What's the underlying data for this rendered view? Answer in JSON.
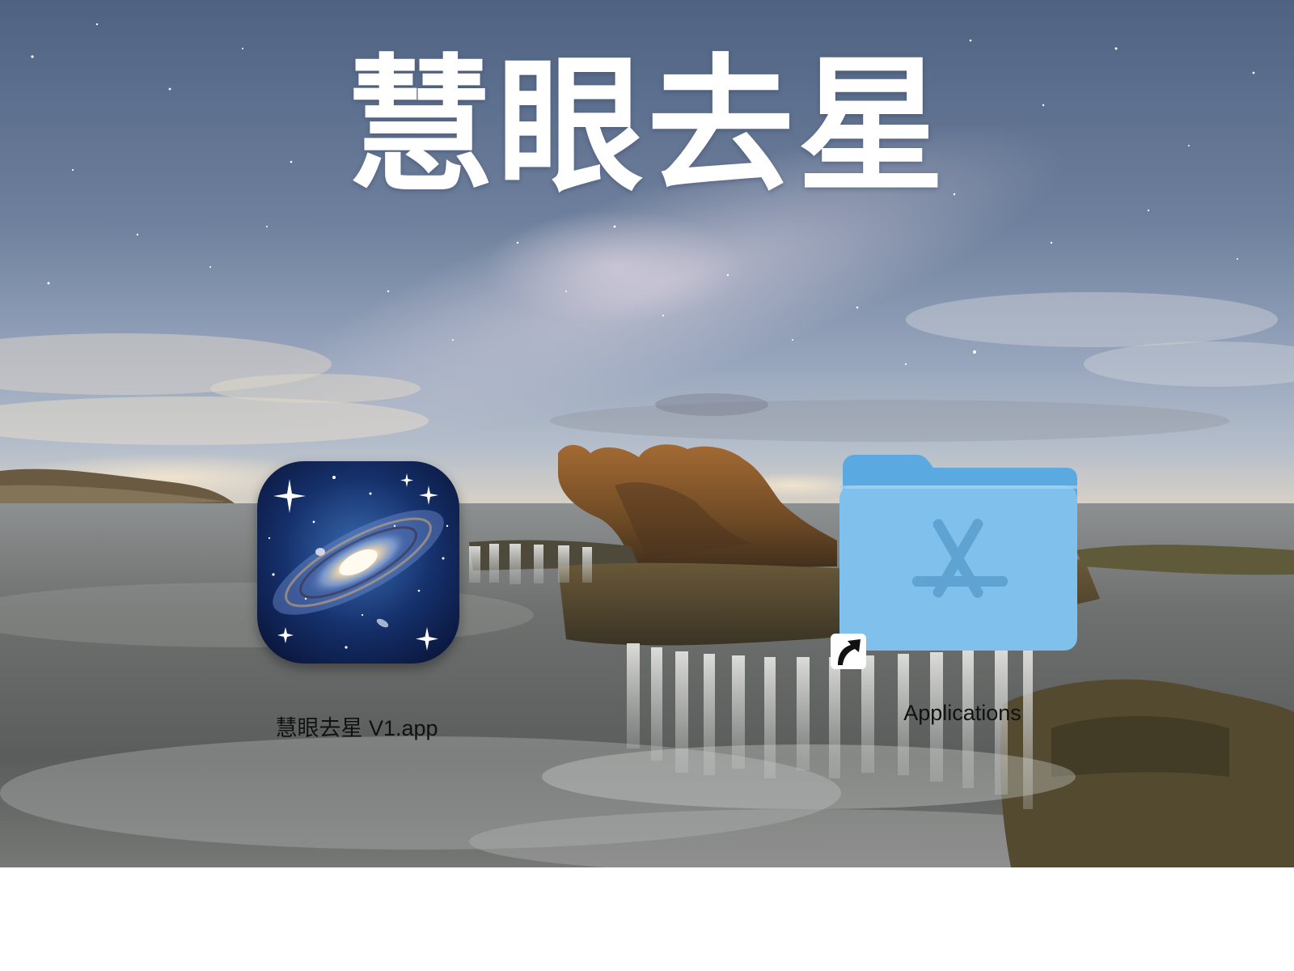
{
  "window": {
    "title_banner": "慧眼去星"
  },
  "items": [
    {
      "label": "慧眼去星 V1.app",
      "kind": "application",
      "icon": "galaxy-app-icon"
    },
    {
      "label": "Applications",
      "kind": "folder-alias",
      "icon": "applications-folder-icon"
    }
  ],
  "colors": {
    "sky_top": "#5f7290",
    "sky_mid": "#a7b4c8",
    "horizon_glow": "#e9dccb",
    "sea": "#7f8280",
    "rock": "#8a5a2b",
    "folder_blue": "#7fc0ec",
    "folder_tab_blue": "#5aa9e0",
    "title_text": "#ffffff",
    "label_text": "#111111"
  }
}
